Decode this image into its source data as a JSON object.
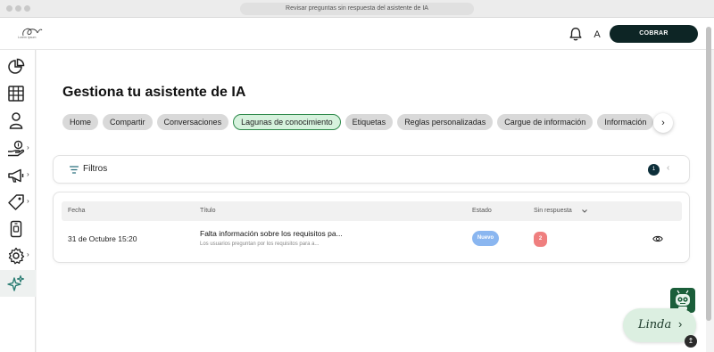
{
  "window": {
    "title": "Revisar preguntas sin respuesta del asistente de IA"
  },
  "header": {
    "logo_text": "Lorem Ipsum",
    "avatar_initial": "A",
    "cobrar_label": "COBRAR"
  },
  "sidebar": {
    "items": [
      {
        "icon": "pie-chart-icon",
        "has_submenu": false,
        "active": false
      },
      {
        "icon": "table-icon",
        "has_submenu": false,
        "active": false
      },
      {
        "icon": "user-icon",
        "has_submenu": false,
        "active": false
      },
      {
        "icon": "hand-coin-icon",
        "has_submenu": true,
        "active": false
      },
      {
        "icon": "megaphone-icon",
        "has_submenu": true,
        "active": false
      },
      {
        "icon": "tag-icon",
        "has_submenu": true,
        "active": false
      },
      {
        "icon": "phone-icon",
        "has_submenu": false,
        "active": false
      },
      {
        "icon": "gear-icon",
        "has_submenu": true,
        "active": false
      },
      {
        "icon": "sparkle-icon",
        "has_submenu": false,
        "active": true
      }
    ],
    "chevron": "›"
  },
  "main": {
    "title": "Gestiona tu asistente de IA",
    "tabs": [
      {
        "label": "Home"
      },
      {
        "label": "Compartir"
      },
      {
        "label": "Conversaciones"
      },
      {
        "label": "Lagunas de conocimiento"
      },
      {
        "label": "Etiquetas"
      },
      {
        "label": "Reglas personalizadas"
      },
      {
        "label": "Cargue de información"
      },
      {
        "label": "Información"
      }
    ],
    "active_tab": "Lagunas de conocimiento",
    "filters": {
      "label": "Filtros",
      "count": "1"
    },
    "table": {
      "columns": [
        "Fecha",
        "Título",
        "Estado",
        "Sin respuesta"
      ],
      "rows": [
        {
          "fecha": "31 de Octubre 15:20",
          "titulo": "Falta información sobre los requisitos pa...",
          "subtitulo": "Los usuarios preguntan por los requisitos para a...",
          "estado": "Nuevo",
          "sin_respuesta": "2"
        }
      ]
    }
  },
  "assistant": {
    "label": "Linda"
  },
  "colors": {
    "brand_dark": "#0d2525",
    "active_tab_bg": "#d6f2dd",
    "active_tab_border": "#2e8a4b",
    "badge_new": "#8ab6f0",
    "badge_count": "#ef7f7f"
  }
}
